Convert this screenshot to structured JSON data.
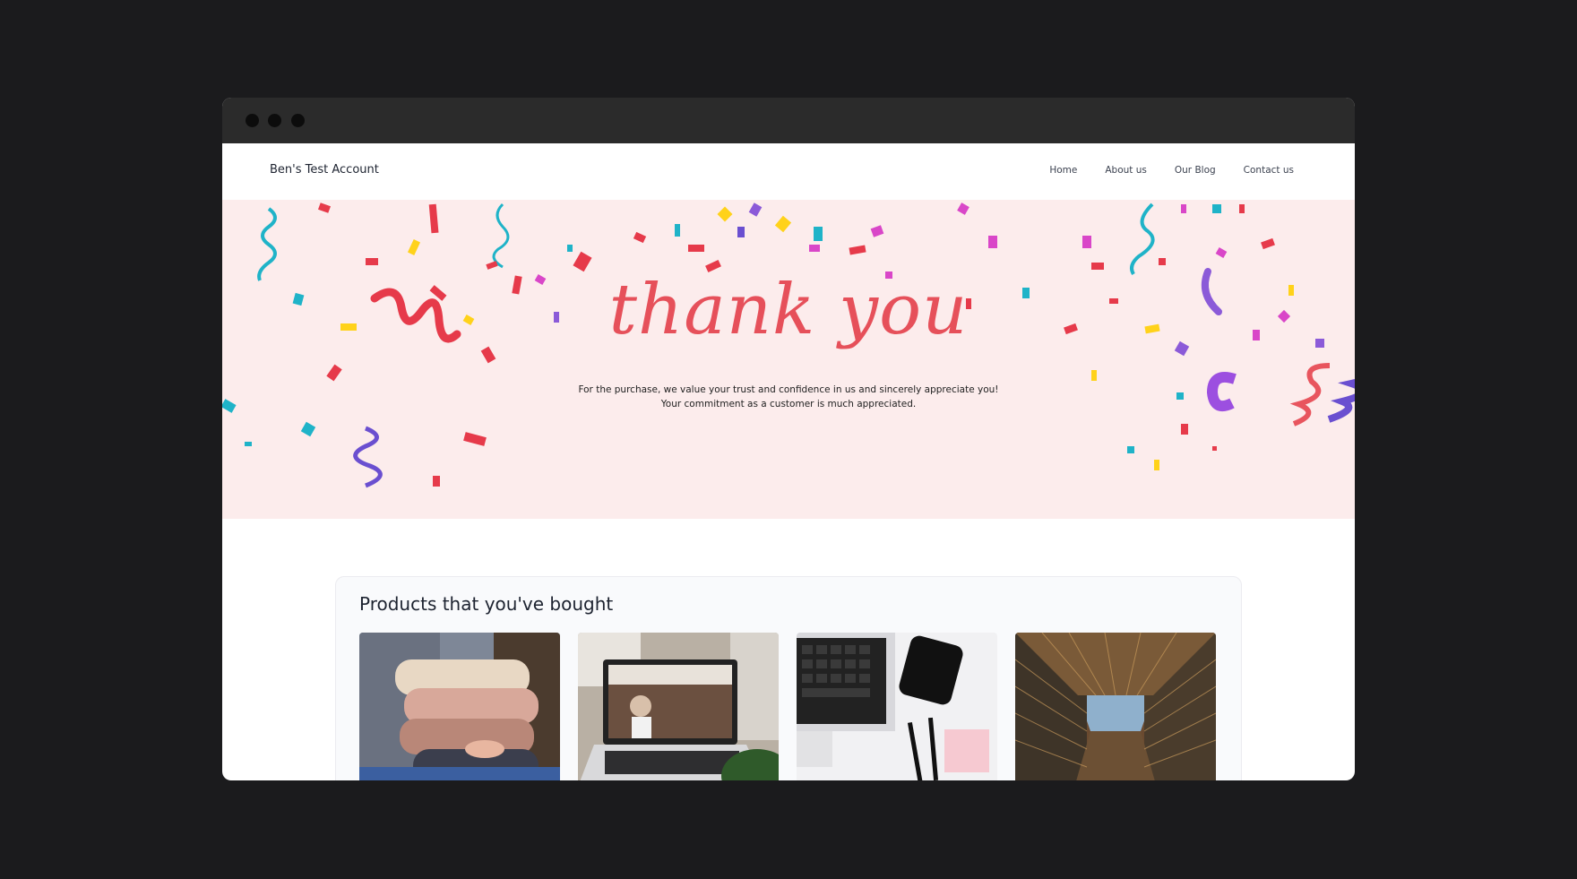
{
  "site": {
    "brand": "Ben's Test Account"
  },
  "nav": {
    "items": [
      {
        "label": "Home"
      },
      {
        "label": "About us"
      },
      {
        "label": "Our Blog"
      },
      {
        "label": "Contact us"
      }
    ]
  },
  "hero": {
    "title": "thank you",
    "message": "For the purchase, we value your trust and confidence in us and sincerely appreciate you! Your commitment as a customer is much appreciated.",
    "background": "#fcecec",
    "accent": "#e6505a"
  },
  "products": {
    "heading": "Products that you've bought"
  }
}
